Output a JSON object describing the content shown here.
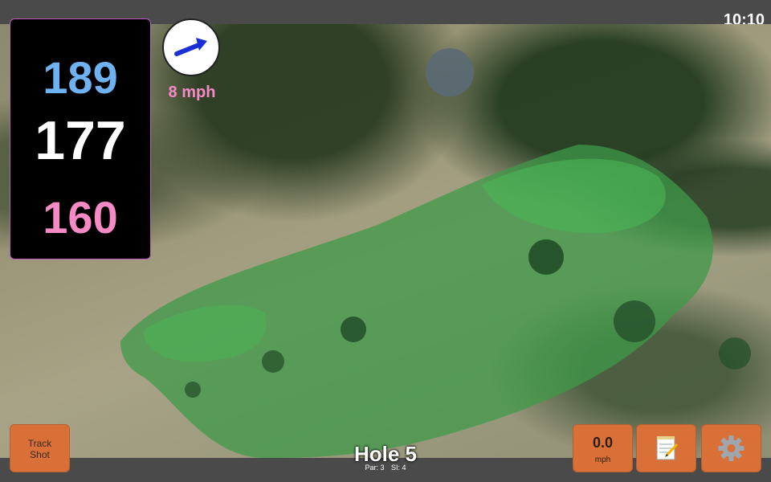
{
  "status_bar": {
    "time": "10:10"
  },
  "distances": {
    "back": "189",
    "center": "177",
    "front": "160",
    "colors": {
      "back": "#6fb2f2",
      "center": "#ffffff",
      "front": "#f58ac4"
    }
  },
  "wind": {
    "speed_label": "8 mph",
    "arrow_icon": "wind-direction-arrow-icon",
    "arrow_color": "#1a2fd6",
    "label_color": "#f58ac4"
  },
  "hole": {
    "title": "Hole 5",
    "par": "Par: 3",
    "stroke_index": "SI: 4"
  },
  "buttons": {
    "track_shot_line1": "Track",
    "track_shot_line2": "Shot",
    "speed_value": "0.0",
    "speed_unit": "mph",
    "notes_icon": "notepad-icon",
    "settings_icon": "gear-icon"
  },
  "colors": {
    "button": "#d97038",
    "bar": "#4a4a4a",
    "fairway": "#3f9a4a"
  }
}
